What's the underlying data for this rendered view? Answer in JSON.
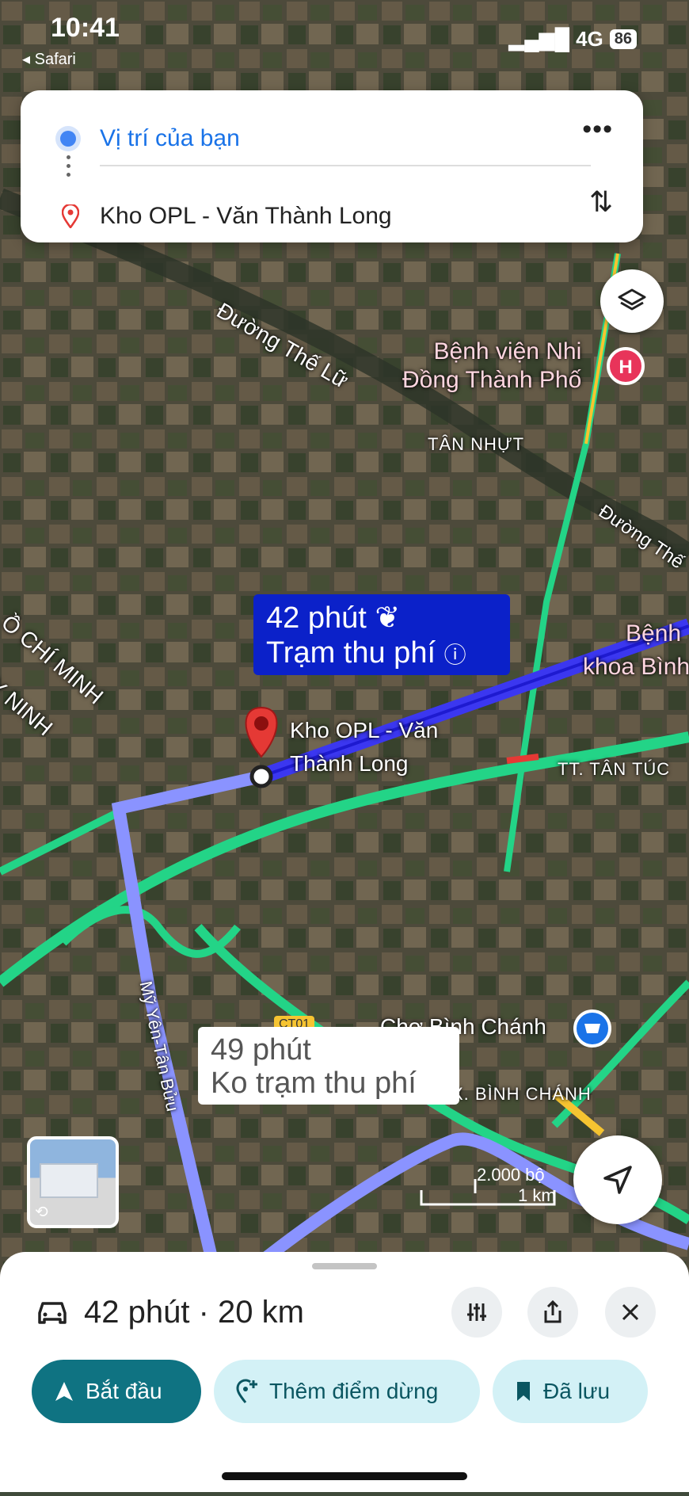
{
  "status_bar": {
    "time": "10:41",
    "back_app": "Safari",
    "network": "4G",
    "battery": "86"
  },
  "directions": {
    "origin": "Vị trí của bạn",
    "destination": "Kho OPL - Văn Thành Long"
  },
  "map": {
    "labels": {
      "road_the_lu": "Đường Thế Lữ",
      "hospital": "Bệnh viện Nhi\nĐồng Thành Phố",
      "tan_nhut": "TÂN NHỰT",
      "road_the_right": "Đường Thế",
      "benh_right": "Bệnh",
      "khoa_binh": "khoa Bình",
      "ho_chi_minh": "Ồ CHÍ MINH",
      "ninh": "Y NINH",
      "destination_label_1": "Kho OPL - Văn",
      "destination_label_2": "Thành Long",
      "tan_tuc": "TT. TÂN TÚC",
      "road_my_yen": "Mỹ Yên-Tân Bửu",
      "cho_binh_chanh": "Chợ Bình Chánh",
      "binh_chanh": "X. BÌNH CHÁNH",
      "ct01": "CT01"
    },
    "colors": {
      "route_primary": "#3b37f0",
      "route_alt": "#8a93ff",
      "traffic_green": "#23d487",
      "traffic_yellow": "#f6c431",
      "traffic_red": "#e53935"
    }
  },
  "callouts": {
    "primary_time": "42 phút",
    "primary_note": "Trạm thu phí",
    "alt_time": "49 phút",
    "alt_note": "Ko trạm thu phí"
  },
  "scale": {
    "feet": "2.000 bộ",
    "km": "1 km"
  },
  "sheet": {
    "summary": "42 phút · 20 km",
    "start_label": "Bắt đầu",
    "add_stop_label": "Thêm điểm dừng",
    "saved_label": "Đã lưu"
  }
}
